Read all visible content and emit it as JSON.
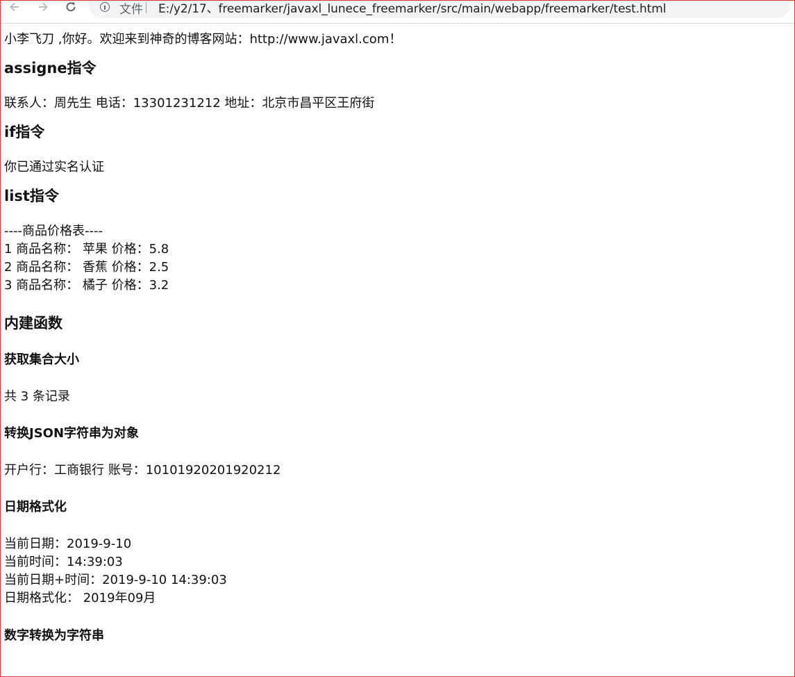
{
  "browser": {
    "back_icon": "arrow-left-icon",
    "forward_icon": "arrow-right-icon",
    "reload_icon": "reload-icon",
    "info_icon": "info-icon",
    "scheme_label": "文件",
    "url": "E:/y2/17、freemarker/javaxl_lunece_freemarker/src/main/webapp/freemarker/test.html"
  },
  "page": {
    "greeting": "小李飞刀 ,你好。欢迎来到神奇的博客网站：http://www.javaxl.com！",
    "assign": {
      "heading": "assigne指令",
      "text": "联系人：周先生 电话：13301231212 地址：北京市昌平区王府街"
    },
    "if": {
      "heading": "if指令",
      "text": "你已通过实名认证"
    },
    "list": {
      "heading": "list指令",
      "title": "----商品价格表----",
      "items": [
        "1 商品名称： 苹果 价格：5.8",
        "2 商品名称： 香蕉 价格：2.5",
        "3 商品名称： 橘子 价格：3.2"
      ]
    },
    "builtin": {
      "heading": "内建函数",
      "size": {
        "heading": "获取集合大小",
        "text": "共 3 条记录"
      },
      "json": {
        "heading": "转换JSON字符串为对象",
        "text": "开户行：工商银行 账号：10101920201920212"
      },
      "date": {
        "heading": "日期格式化",
        "lines": [
          "当前日期：2019-9-10",
          "当前时间：14:39:03",
          "当前日期+时间：2019-9-10 14:39:03",
          "日期格式化： 2019年09月"
        ]
      },
      "number": {
        "heading": "数字转换为字符串"
      }
    }
  }
}
